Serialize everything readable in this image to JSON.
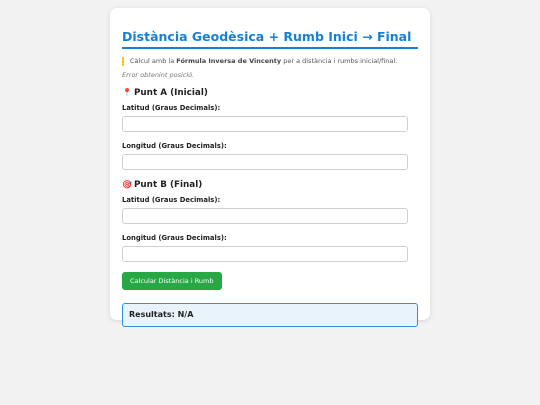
{
  "title": "Distància Geodèsica + Rumb Inici → Final",
  "note": {
    "prefix": "Càlcul amb la ",
    "bold": "Fórmula Inversa de Vincenty",
    "suffix": " per a distància i rumbs inicial/final."
  },
  "error_text": "Error obtenint posició.",
  "point_a": {
    "icon": "pin-icon",
    "icon_glyph": "📍",
    "heading": "Punt A (Inicial)",
    "lat_label": "Latitud (Graus Decimals):",
    "lat_value": "",
    "lon_label": "Longitud (Graus Decimals):",
    "lon_value": ""
  },
  "point_b": {
    "icon": "target-icon",
    "icon_glyph": "🎯",
    "heading": "Punt B (Final)",
    "lat_label": "Latitud (Graus Decimals):",
    "lat_value": "",
    "lon_label": "Longitud (Graus Decimals):",
    "lon_value": ""
  },
  "calculate_button": "Calcular Distància i Rumb",
  "results": "Resultats: N/A",
  "colors": {
    "accent": "#1a7fd4",
    "button": "#28a745",
    "note_border": "#f5c518",
    "result_bg": "#e8f3fc"
  }
}
